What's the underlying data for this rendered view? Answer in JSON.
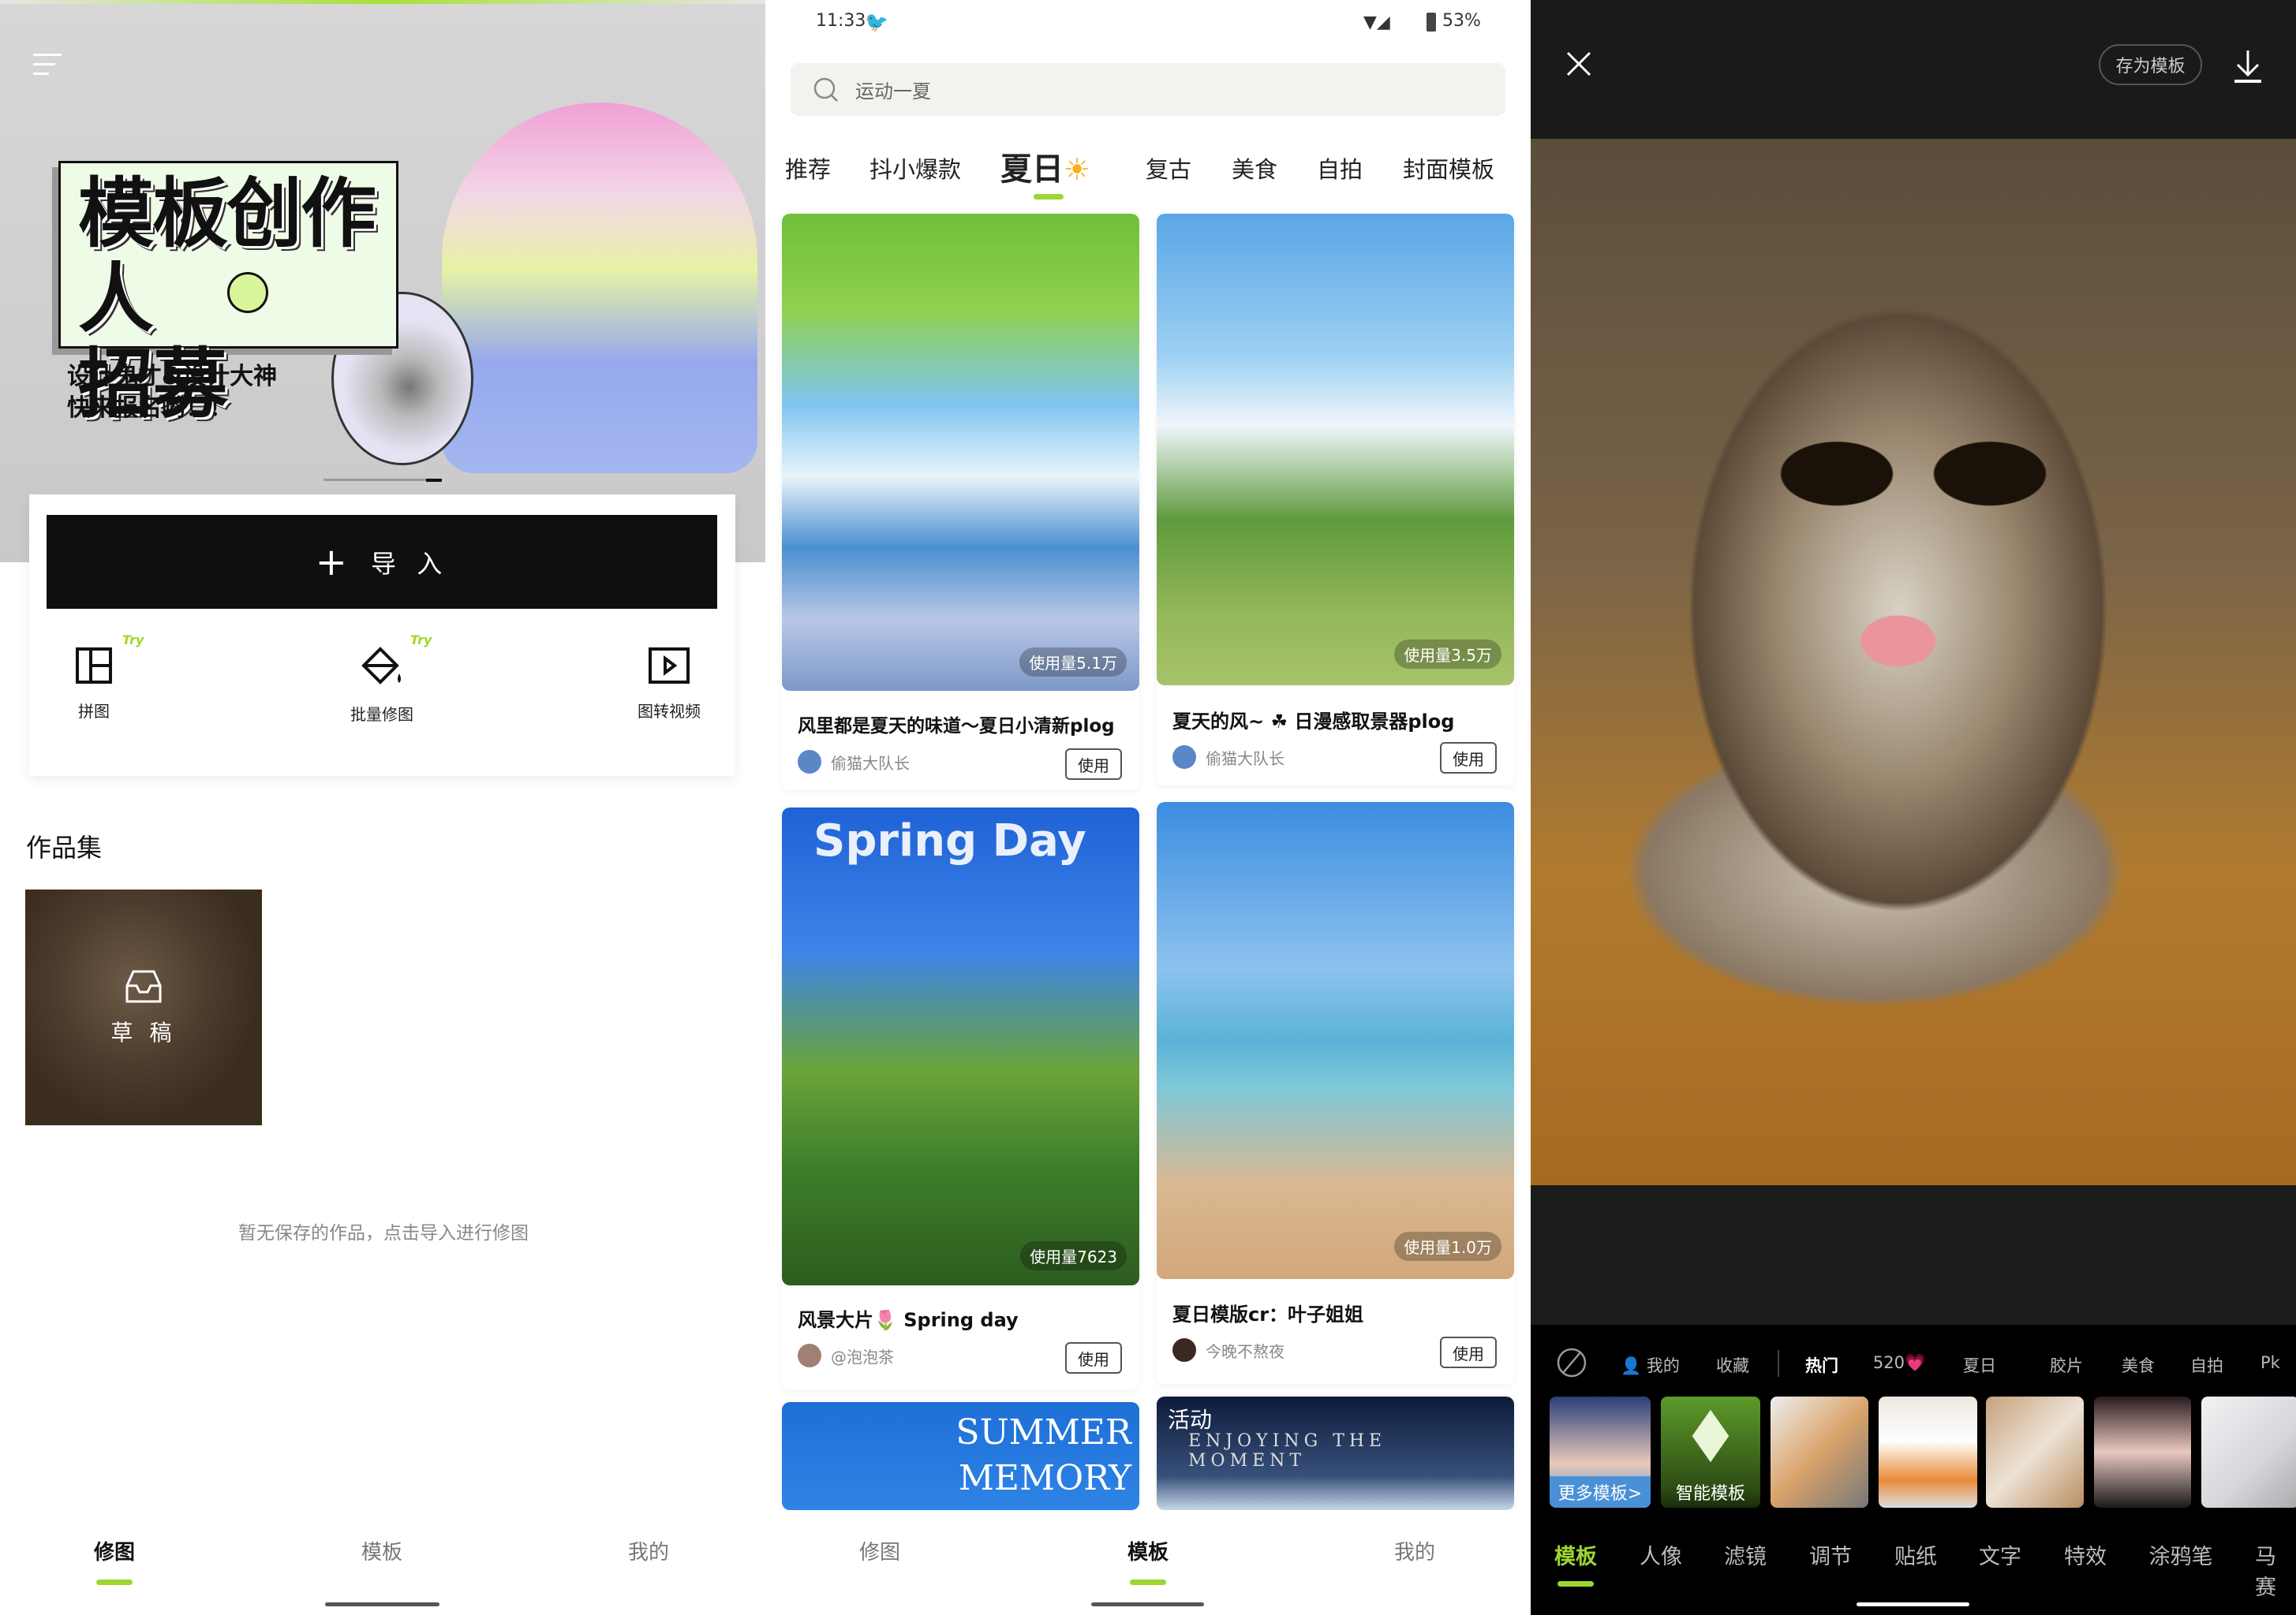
{
  "left": {
    "banner": {
      "title_line1": "模板创作人",
      "title_line2": "招募",
      "subtitle_line1": "设计鬼才&设计大神",
      "subtitle_line2": "快来报名哟！！"
    },
    "import_label": "导 入",
    "tools": [
      {
        "label": "拼图",
        "badge": "Try",
        "icon": "grid-layout-icon"
      },
      {
        "label": "批量修图",
        "badge": "Try",
        "icon": "paint-bucket-icon"
      },
      {
        "label": "图转视频",
        "icon": "play-video-icon"
      }
    ],
    "section_title": "作品集",
    "draft_label": "草 稿",
    "empty_text": "暂无保存的作品，点击导入进行修图",
    "nav": [
      {
        "label": "修图",
        "active": true
      },
      {
        "label": "模板"
      },
      {
        "label": "我的"
      }
    ]
  },
  "middle": {
    "status": {
      "time": "11:33",
      "battery": "53%"
    },
    "search_placeholder": "运动一夏",
    "tabs": [
      {
        "label": "推荐"
      },
      {
        "label": "抖小爆款"
      },
      {
        "label": "夏日",
        "active": true
      },
      {
        "label": "复古"
      },
      {
        "label": "美食"
      },
      {
        "label": "自拍"
      },
      {
        "label": "封面模板"
      }
    ],
    "cards": [
      {
        "title": "风里都是夏天的味道～夏日小清新plog",
        "author": "偷猫大队长",
        "usage": "使用量5.1万",
        "use_label": "使用"
      },
      {
        "title": "夏天的风~ ☘ 日漫感取景器plog",
        "author": "偷猫大队长",
        "usage": "使用量3.5万",
        "use_label": "使用"
      },
      {
        "title": "风景大片🌷 Spring day",
        "author": "@泡泡茶",
        "usage": "使用量7623",
        "use_label": "使用",
        "overlay": "Spring Day"
      },
      {
        "title": "夏日模版cr：叶子姐姐",
        "author": "今晚不熬夜",
        "usage": "使用量1.0万",
        "use_label": "使用"
      }
    ],
    "card5_text": "SUMMER MEMORY",
    "card6_badge": "活动",
    "card6_text": "ENJOYING THE MOMENT",
    "nav": [
      {
        "label": "修图"
      },
      {
        "label": "模板",
        "active": true
      },
      {
        "label": "我的"
      }
    ]
  },
  "right": {
    "save_template_label": "存为模板",
    "categories": [
      {
        "label": "我的"
      },
      {
        "label": "收藏"
      },
      {
        "label": "热门",
        "active": true
      },
      {
        "label": "520💗"
      },
      {
        "label": "夏日"
      },
      {
        "label": "胶片"
      },
      {
        "label": "美食"
      },
      {
        "label": "自拍"
      },
      {
        "label": "Pk"
      }
    ],
    "thumbs": [
      {
        "label": "更多模板>"
      },
      {
        "label": "智能模板"
      }
    ],
    "tabs": [
      {
        "label": "模板",
        "active": true
      },
      {
        "label": "人像"
      },
      {
        "label": "滤镜"
      },
      {
        "label": "调节"
      },
      {
        "label": "贴纸"
      },
      {
        "label": "文字"
      },
      {
        "label": "特效"
      },
      {
        "label": "涂鸦笔"
      },
      {
        "label": "马赛"
      }
    ]
  },
  "colors": {
    "accent": "#9ed531",
    "dark": "#0f0f0f"
  }
}
